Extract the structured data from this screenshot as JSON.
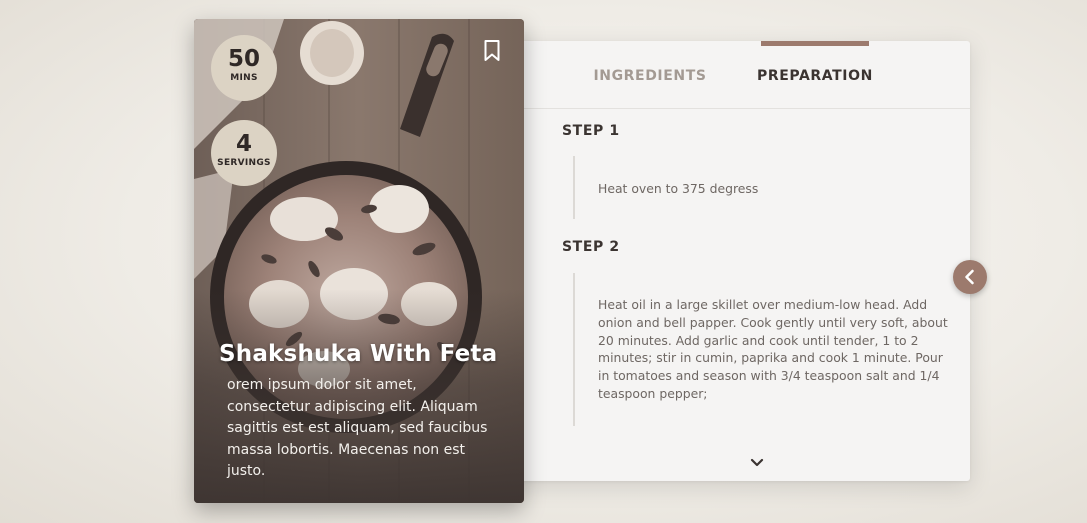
{
  "card": {
    "time_value": "50",
    "time_unit": "MINS",
    "servings_value": "4",
    "servings_unit": "SERVINGS",
    "title": "Shakshuka With Feta",
    "description": "orem ipsum dolor sit amet, consectetur adipiscing elit. Aliquam sagittis est est aliquam, sed faucibus massa lobortis. Maecenas non est justo."
  },
  "tabs": {
    "ingredients": "INGREDIENTS",
    "preparation": "PREPARATION",
    "active": "preparation"
  },
  "steps": [
    {
      "title": "STEP 1",
      "text": "Heat oven to 375 degress"
    },
    {
      "title": "STEP 2",
      "text": "Heat oil in a large skillet over medium-low head. Add onion and bell papper. Cook gently until very soft, about 20 minutes. Add garlic and cook until tender, 1 to 2 minutes; stir in cumin, paprika and cook 1 minute. Pour in tomatoes and season with 3/4 teaspoon salt and 1/4 teaspoon pepper;"
    }
  ],
  "icons": {
    "bookmark": "bookmark-icon",
    "scroll_down": "chevron-down-icon",
    "previous": "chevron-left-icon"
  },
  "colors": {
    "accent": "#9c7a6d",
    "badge": "#dcd3c4",
    "panel": "#f5f4f3"
  }
}
